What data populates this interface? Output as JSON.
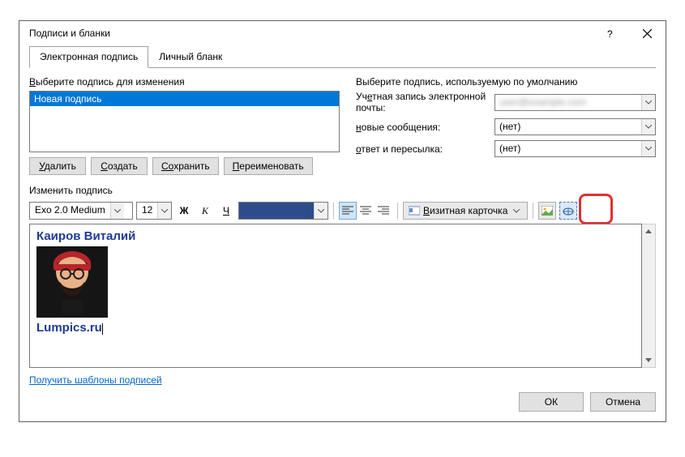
{
  "window": {
    "title": "Подписи и бланки"
  },
  "tabs": {
    "signature": "Электронная подпись",
    "stationery": "Личный бланк"
  },
  "left": {
    "section_label": "Выберите подпись для изменения",
    "items": [
      "Новая подпись"
    ],
    "buttons": {
      "delete": "Удалить",
      "new": "Создать",
      "save": "Сохранить",
      "rename": "Переименовать"
    }
  },
  "right": {
    "section_label": "Выберите подпись, используемую по умолчанию",
    "row_account": "Учетная запись электронной почты:",
    "row_new": "новые сообщения:",
    "row_reply": "ответ и пересылка:",
    "val_none": "(нет)"
  },
  "edit": {
    "label": "Изменить подпись",
    "font_name": "Exo 2.0 Medium",
    "font_size": "12",
    "bold": "Ж",
    "italic": "К",
    "underline": "Ч",
    "bizcard": "Визитная карточка"
  },
  "content": {
    "name": "Каиров Виталий",
    "site": "Lumpics.ru"
  },
  "footer": {
    "templates": "Получить шаблоны подписей"
  },
  "buttons": {
    "ok": "ОК",
    "cancel": "Отмена"
  }
}
